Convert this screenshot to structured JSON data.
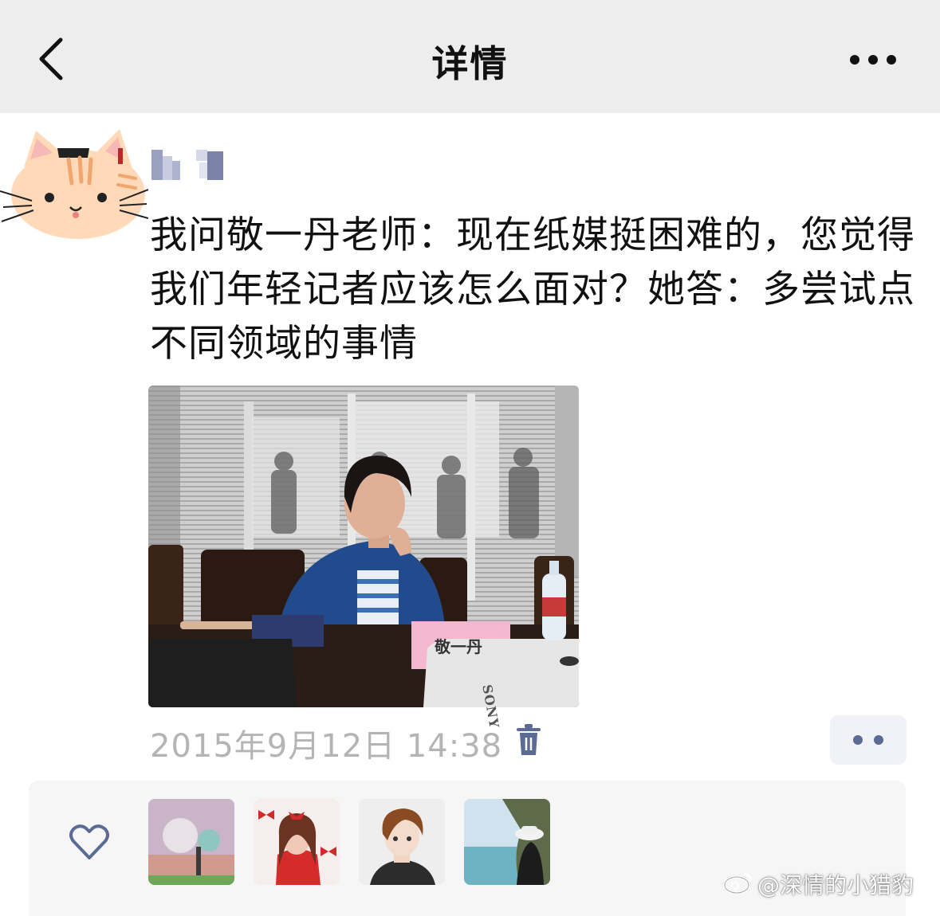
{
  "nav": {
    "title": "详情",
    "back_icon": "chevron-left-icon",
    "more_icon": "ellipsis-icon"
  },
  "post": {
    "text": "我问敬一丹老师：现在纸媒挺困难的，您觉得我们年轻记者应该怎么面对？她答：多尝试点不同领域的事情",
    "photo": {
      "nameplate": "敬一丹",
      "projector_brand": "SONY"
    },
    "timestamp": "2015年9月12日 14:38"
  },
  "likes": {
    "icon": "heart-outline-icon",
    "count_shown": 4
  },
  "watermark": "@深情的小猎豹",
  "colors": {
    "nav_bg": "#ededed",
    "time_text": "#b4b4b4",
    "trash": "#5b6b94",
    "panel_bg": "#f6f6f6"
  }
}
